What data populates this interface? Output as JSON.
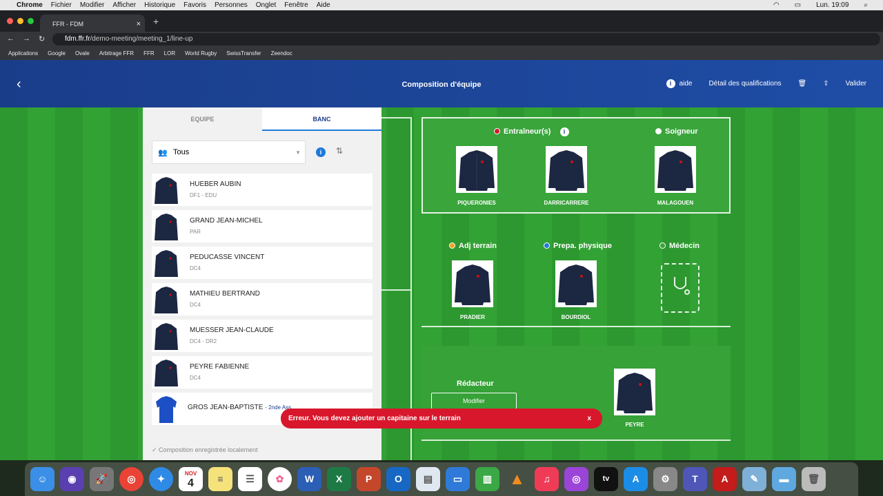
{
  "menubar": {
    "apple": "",
    "app": "Chrome",
    "items": [
      "Fichier",
      "Modifier",
      "Afficher",
      "Historique",
      "Favoris",
      "Personnes",
      "Onglet",
      "Fenêtre",
      "Aide"
    ],
    "clock": "Lun. 19:09"
  },
  "browser": {
    "tab_title": "FFR - FDM",
    "url_domain": "fdm.ffr.fr",
    "url_path": "/demo-meeting/meeting_1/line-up"
  },
  "bookmarks": [
    "Applications",
    "Google",
    "Ovale",
    "Arbitrage FFR",
    "FFR",
    "LOR",
    "World Rugby",
    "SwissTransfer",
    "Zeendoc"
  ],
  "header": {
    "back": "‹",
    "title": "Composition d'équipe",
    "aide": "aide",
    "info": "i",
    "qualif": "Détail des qualifications",
    "trash": "🗑",
    "share": "⇪",
    "validate": "Valider"
  },
  "panel": {
    "tab_equipe": "EQUIPE",
    "tab_banc": "BANC",
    "filter_value": "Tous",
    "saved": "✓ Composition enregistrée localement",
    "players": [
      {
        "name": "HUEBER AUBIN",
        "role": "DF1 - EDU"
      },
      {
        "name": "GRAND JEAN-MICHEL",
        "role": "PAR"
      },
      {
        "name": "PEDUCASSE VINCENT",
        "role": "DC4"
      },
      {
        "name": "MATHIEU BERTRAND",
        "role": "DC4"
      },
      {
        "name": "MUESSER JEAN-CLAUDE",
        "role": "DC4 - DR2"
      },
      {
        "name": "PEYRE FABIENNE",
        "role": "DC4"
      },
      {
        "name": "GROS JEAN-BAPTISTE",
        "role": "- 2nde Ass"
      }
    ]
  },
  "staff": {
    "entraineur": {
      "label": "Entraîneur(s)",
      "color": "#d8172c",
      "info": "i"
    },
    "soigneur": {
      "label": "Soigneur",
      "color": "#ffffff"
    },
    "adj": {
      "label": "Adj terrain",
      "color": "#f0a020"
    },
    "prepa": {
      "label": "Prepa. physique",
      "color": "#1f7ad8"
    },
    "medecin": {
      "label": "Médecin",
      "color": "#37a538"
    },
    "members": {
      "piqueronies": "PIQUERONIES",
      "darricarrere": "DARRICARRERE",
      "malagouen": "MALAGOUEN",
      "pradier": "PRADIER",
      "bourdiol": "BOURDIOL",
      "peyre": "PEYRE"
    }
  },
  "redacteur": {
    "label": "Rédacteur",
    "modify": "Modifier"
  },
  "toast": {
    "message": "Erreur. Vous devez ajouter un capitaine sur le terrain",
    "close": "x"
  },
  "dock": {
    "calendar_month": "NOV",
    "calendar_day": "4"
  }
}
